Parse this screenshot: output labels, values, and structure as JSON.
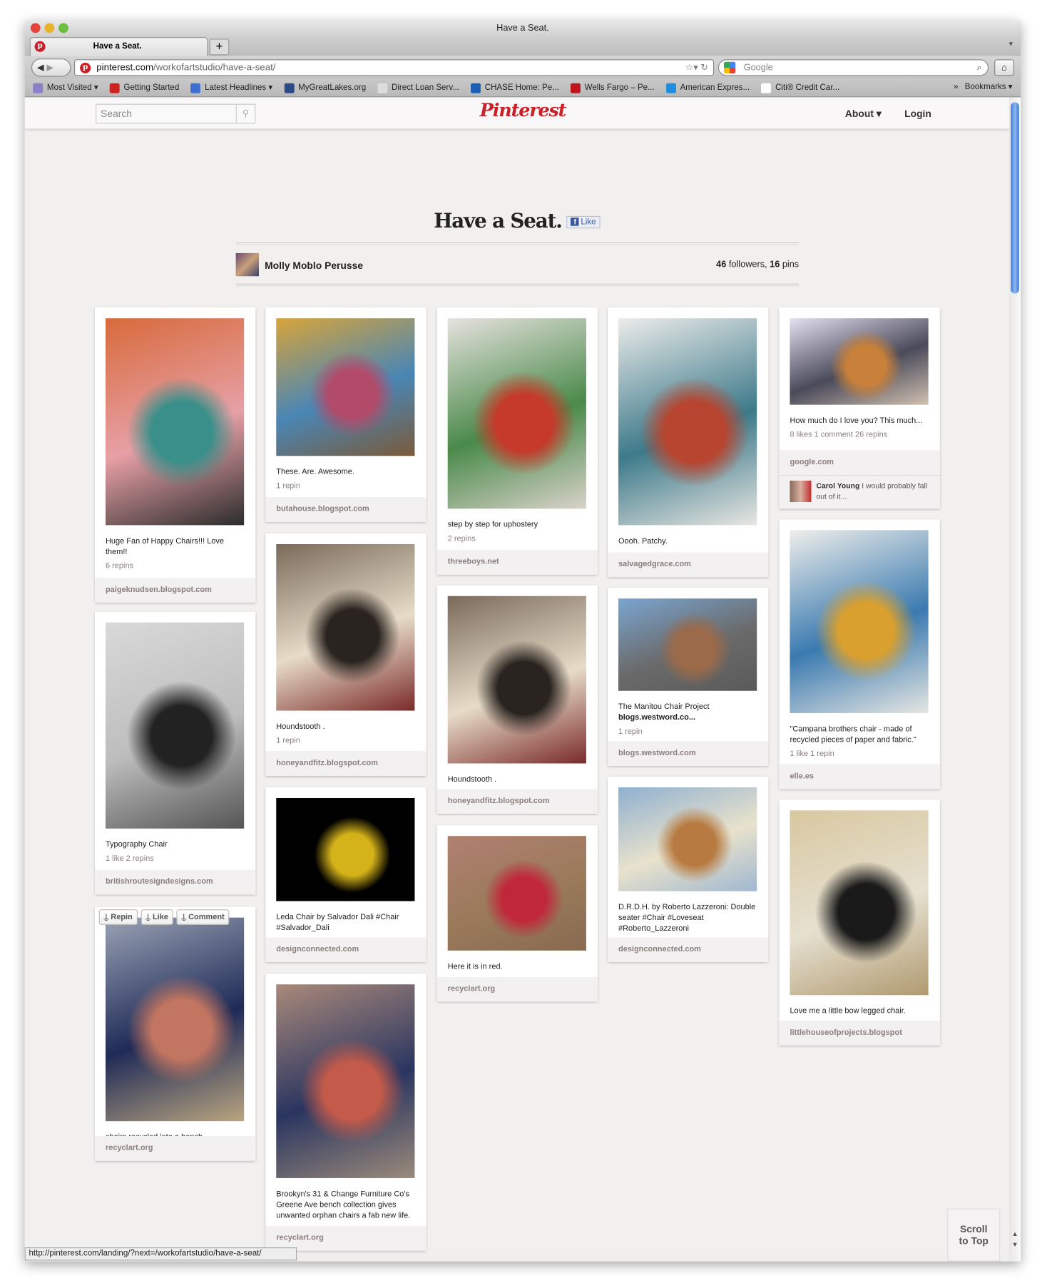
{
  "window": {
    "title": "Have a Seat.",
    "tab_title": "Have a Seat.",
    "new_tab": "+"
  },
  "navbar": {
    "url_domain": "pinterest.com",
    "url_path": "/workofartstudio/have-a-seat/",
    "search_placeholder": "Google"
  },
  "bookmarks": [
    {
      "label": "Most Visited ▾",
      "color": "#8a7fc9"
    },
    {
      "label": "Getting Started",
      "color": "#cc2222"
    },
    {
      "label": "Latest Headlines ▾",
      "color": "#3b6fd1"
    },
    {
      "label": "MyGreatLakes.org",
      "color": "#2a4a8a"
    },
    {
      "label": "Direct Loan Serv...",
      "color": "#dddddd"
    },
    {
      "label": "CHASE Home: Pe...",
      "color": "#1a5fb4"
    },
    {
      "label": "Wells Fargo – Pe...",
      "color": "#c0141c"
    },
    {
      "label": "American Expres...",
      "color": "#1e8fe0"
    },
    {
      "label": "Citi® Credit Car...",
      "color": "#ffffff"
    }
  ],
  "bookmarks_more": "»",
  "bookmarks_menu": "Bookmarks ▾",
  "header": {
    "search_placeholder": "Search",
    "logo": "Pinterest",
    "about": "About ▾",
    "login": "Login"
  },
  "board": {
    "title": "Have a Seat.",
    "fb_like": "Like",
    "owner": "Molly Moblo Perusse",
    "followers": "46",
    "followers_label": " followers, ",
    "pins": "16",
    "pins_label": " pins"
  },
  "pin_buttons": {
    "repin": "Repin",
    "like": "Like",
    "comment": "Comment"
  },
  "pins": [
    {
      "caption": "Huge Fan of Happy Chairs!!! Love them!!",
      "stats": "6 repins",
      "source": "paigeknudsen.blogspot.com",
      "colors": [
        "#d76a3b",
        "#3a8f8a",
        "#e7a0a6",
        "#2c2c2c"
      ]
    },
    {
      "caption": "Typography Chair",
      "stats": "1 like  2 repins",
      "source": "britishroutesigndesigns.com",
      "colors": [
        "#d9d9d9",
        "#222222",
        "#bdbdbd",
        "#555555"
      ]
    },
    {
      "caption": "chairs recycled into a bench.",
      "stats": "",
      "source": "recyclart.org",
      "colors": [
        "#9aa3b4",
        "#c27560",
        "#1f2a57",
        "#b9a57f"
      ]
    },
    {
      "caption": "These. Are. Awesome.",
      "stats": "1 repin",
      "source": "butahouse.blogspot.com",
      "colors": [
        "#d8a43a",
        "#b24a6a",
        "#4a86b5",
        "#7a5a3a"
      ]
    },
    {
      "caption": "Houndstooth .",
      "stats": "1 repin",
      "source": "honeyandfitz.blogspot.com",
      "colors": [
        "#7a6a5a",
        "#2a2420",
        "#e7dcc8",
        "#7a2a2a"
      ]
    },
    {
      "caption": "Leda Chair by Salvador Dali #Chair #Salvador_Dali",
      "stats": "",
      "source": "designconnected.com",
      "colors": [
        "#000000",
        "#d4b21a",
        "#000000",
        "#000000"
      ]
    },
    {
      "caption": "Brookyn's 31 & Change Furniture Co's Greene Ave bench collection gives unwanted orphan chairs a fab new life.",
      "stats": "",
      "source": "recyclart.org",
      "colors": [
        "#a9897a",
        "#c45a4a",
        "#2a3560",
        "#9a8a7a"
      ]
    },
    {
      "caption": "step by step for uphostery",
      "stats": "2 repins",
      "source": "threeboys.net",
      "colors": [
        "#e6e2de",
        "#c53a2a",
        "#4a8a4a",
        "#d9d2ca"
      ]
    },
    {
      "caption": "Houndstooth .",
      "stats": "",
      "source": "honeyandfitz.blogspot.com",
      "colors": [
        "#7a6a5a",
        "#2a2420",
        "#e7dcc8",
        "#7a2a2a"
      ]
    },
    {
      "caption": "Here it is in red.",
      "stats": "",
      "source": "recyclart.org",
      "colors": [
        "#b08070",
        "#c0283a",
        "#9a7a5a",
        "#8a6a50"
      ]
    },
    {
      "caption": "Oooh. Patchy.",
      "stats": "",
      "source": "salvagedgrace.com",
      "colors": [
        "#ececea",
        "#b8452f",
        "#3d7a8a",
        "#e8e6e2"
      ]
    },
    {
      "caption": "The Manitou Chair Project blogs.westword.co...",
      "caption_bold_tail": true,
      "stats": "1 repin",
      "source": "blogs.westword.com",
      "colors": [
        "#7aa5d0",
        "#9a6a4a",
        "#6a6a6a",
        "#5a5a5a"
      ]
    },
    {
      "caption": "D.R.D.H. by Roberto Lazzeroni: Double seater #Chair #Loveseat #Roberto_Lazzeroni",
      "stats": "",
      "source": "designconnected.com",
      "colors": [
        "#8fb0d0",
        "#b77a40",
        "#e8e2cc",
        "#a0b8d0"
      ]
    },
    {
      "caption": "How much do I love you? This much...",
      "stats": "8 likes  1 comment  26 repins",
      "source": "google.com",
      "comment": {
        "author": "Carol Young",
        "text": " I would probably fall out of it..."
      },
      "colors": [
        "#e4e0f0",
        "#c8803a",
        "#4a4a5a",
        "#d0c0b0"
      ]
    },
    {
      "caption": "\"Campana brothers chair - made of recycled pieces of paper and fabric.\"",
      "stats": "1 like  1 repin",
      "source": "elle.es",
      "colors": [
        "#eeeeea",
        "#d9a030",
        "#3a7ab0",
        "#e6e6e2"
      ]
    },
    {
      "caption": "Love me a little bow legged chair.",
      "stats": "",
      "source": "littlehouseofprojects.blogspot",
      "colors": [
        "#d8c8a0",
        "#1a1a1a",
        "#e6e0d0",
        "#b09a70"
      ]
    }
  ],
  "scroll_to_top": "Scroll to Top",
  "status_bar": "http://pinterest.com/landing/?next=/workofartstudio/have-a-seat/"
}
